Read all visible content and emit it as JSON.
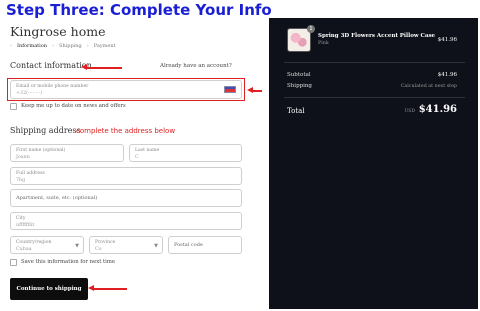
{
  "annotation": {
    "step_title": "Step Three: Complete Your Info",
    "shipping_note": "complete the address below"
  },
  "store": {
    "name": "Kingrose home"
  },
  "breadcrumbs": [
    "Information",
    "Shipping",
    "Payment"
  ],
  "contact": {
    "title": "Contact information",
    "account_link": "Already have an account?",
    "email_label": "Email or mobile phone number",
    "email_value": "+32(········)",
    "newsletter_label": "Keep me up to date on news and offers"
  },
  "shipping": {
    "title": "Shipping address",
    "first_name_label": "First name (optional)",
    "first_name_value": "Joann",
    "last_name_label": "Last name",
    "last_name_value": "C",
    "address_label": "Full address",
    "address_value": "7bg",
    "apartment_placeholder": "Apartment, suite, etc. (optional)",
    "city_label": "City",
    "city_value": "ufffffflit",
    "country_label": "Country/region",
    "country_value": "Cubaa",
    "province_label": "Province",
    "province_value": "Co",
    "postal_placeholder": "Postal code",
    "save_label": "Save this information for next time",
    "continue_label": "Continue to shipping"
  },
  "summary": {
    "item_qty": "1",
    "item_name": "Spring 3D Flowers Accent Pillow Case",
    "item_variant": "Pink",
    "item_price": "$41.96",
    "subtotal_label": "Subtotal",
    "subtotal_value": "$41.96",
    "shipping_label": "Shipping",
    "shipping_value": "Calculated at next step",
    "total_label": "Total",
    "total_currency": "USD",
    "total_value": "$41.96"
  },
  "colors": {
    "annotation_blue": "#1a1fd4",
    "annotation_red": "#e02020",
    "summary_bg": "#0e1119",
    "button_bg": "#0d0d0d"
  }
}
